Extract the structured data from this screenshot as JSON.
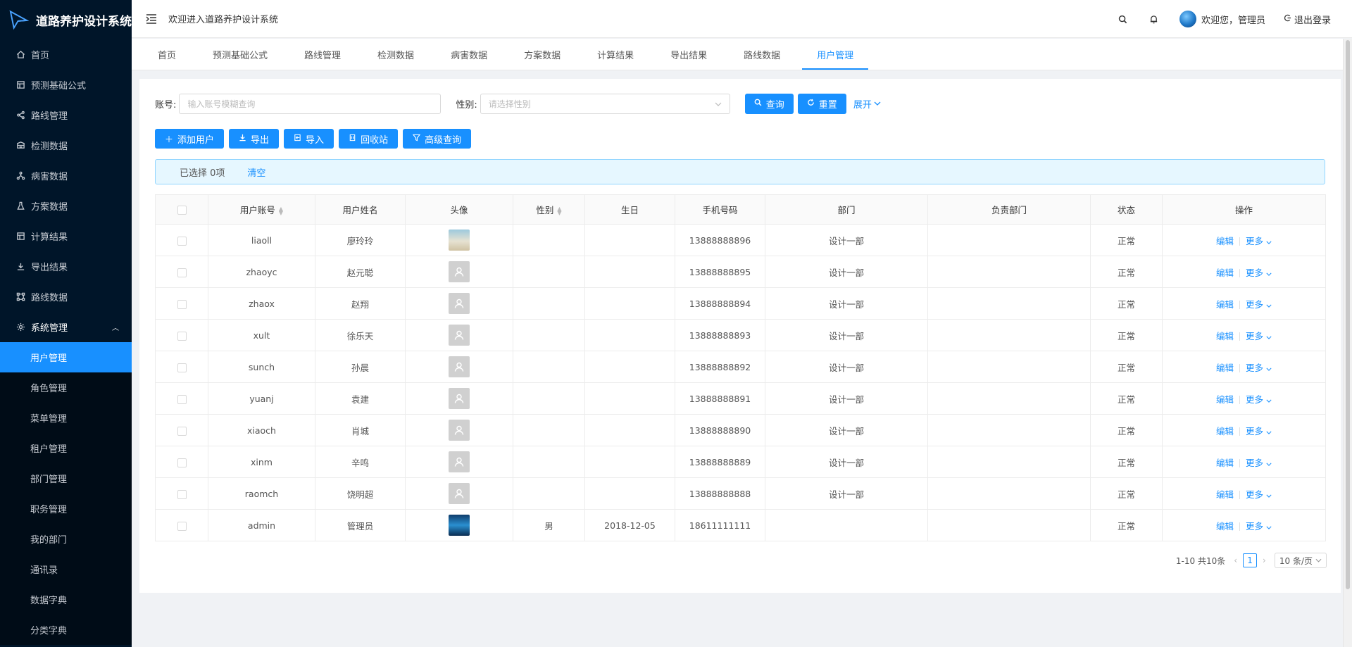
{
  "app": {
    "title": "道路养护设计系统",
    "welcome": "欢迎进入道路养护设计系统"
  },
  "header": {
    "greeting": "欢迎您，管理员",
    "logout": "退出登录"
  },
  "sidebar": {
    "items": [
      {
        "label": "首页",
        "icon": "home-icon"
      },
      {
        "label": "预测基础公式",
        "icon": "table-icon"
      },
      {
        "label": "路线管理",
        "icon": "share-icon"
      },
      {
        "label": "检测数据",
        "icon": "database-icon"
      },
      {
        "label": "病害数据",
        "icon": "cluster-icon"
      },
      {
        "label": "方案数据",
        "icon": "flask-icon"
      },
      {
        "label": "计算结果",
        "icon": "table-icon"
      },
      {
        "label": "导出结果",
        "icon": "download-icon"
      },
      {
        "label": "路线数据",
        "icon": "nodes-icon"
      }
    ],
    "system": {
      "label": "系统管理",
      "children": [
        "用户管理",
        "角色管理",
        "菜单管理",
        "租户管理",
        "部门管理",
        "职务管理",
        "我的部门",
        "通讯录",
        "数据字典",
        "分类字典"
      ]
    }
  },
  "tabs": [
    "首页",
    "预测基础公式",
    "路线管理",
    "检测数据",
    "病害数据",
    "方案数据",
    "计算结果",
    "导出结果",
    "路线数据",
    "用户管理"
  ],
  "active_tab": "用户管理",
  "search": {
    "account_label": "账号:",
    "account_placeholder": "输入账号模糊查询",
    "gender_label": "性别:",
    "gender_placeholder": "请选择性别",
    "query": "查询",
    "reset": "重置",
    "expand": "展开"
  },
  "toolbar": {
    "add": "添加用户",
    "export": "导出",
    "import": "导入",
    "recycle": "回收站",
    "advanced": "高级查询"
  },
  "selection": {
    "text": "已选择 0项",
    "clear": "清空"
  },
  "table": {
    "columns": [
      "用户账号",
      "用户姓名",
      "头像",
      "性别",
      "生日",
      "手机号码",
      "部门",
      "负责部门",
      "状态",
      "操作"
    ],
    "rows": [
      {
        "account": "liaoll",
        "name": "廖玲玲",
        "avatar": "photo-a",
        "gender": "",
        "birthday": "",
        "phone": "13888888896",
        "dept": "设计一部",
        "owner_dept": "",
        "status": "正常"
      },
      {
        "account": "zhaoyc",
        "name": "赵元聪",
        "avatar": "default",
        "gender": "",
        "birthday": "",
        "phone": "13888888895",
        "dept": "设计一部",
        "owner_dept": "",
        "status": "正常"
      },
      {
        "account": "zhaox",
        "name": "赵翔",
        "avatar": "default",
        "gender": "",
        "birthday": "",
        "phone": "13888888894",
        "dept": "设计一部",
        "owner_dept": "",
        "status": "正常"
      },
      {
        "account": "xult",
        "name": "徐乐天",
        "avatar": "default",
        "gender": "",
        "birthday": "",
        "phone": "13888888893",
        "dept": "设计一部",
        "owner_dept": "",
        "status": "正常"
      },
      {
        "account": "sunch",
        "name": "孙晨",
        "avatar": "default",
        "gender": "",
        "birthday": "",
        "phone": "13888888892",
        "dept": "设计一部",
        "owner_dept": "",
        "status": "正常"
      },
      {
        "account": "yuanj",
        "name": "袁建",
        "avatar": "default",
        "gender": "",
        "birthday": "",
        "phone": "13888888891",
        "dept": "设计一部",
        "owner_dept": "",
        "status": "正常"
      },
      {
        "account": "xiaoch",
        "name": "肖城",
        "avatar": "default",
        "gender": "",
        "birthday": "",
        "phone": "13888888890",
        "dept": "设计一部",
        "owner_dept": "",
        "status": "正常"
      },
      {
        "account": "xinm",
        "name": "辛鸣",
        "avatar": "default",
        "gender": "",
        "birthday": "",
        "phone": "13888888889",
        "dept": "设计一部",
        "owner_dept": "",
        "status": "正常"
      },
      {
        "account": "raomch",
        "name": "饶明超",
        "avatar": "default",
        "gender": "",
        "birthday": "",
        "phone": "13888888888",
        "dept": "设计一部",
        "owner_dept": "",
        "status": "正常"
      },
      {
        "account": "admin",
        "name": "管理员",
        "avatar": "photo-b",
        "gender": "男",
        "birthday": "2018-12-05",
        "phone": "18611111111",
        "dept": "",
        "owner_dept": "",
        "status": "正常"
      }
    ],
    "edit_label": "编辑",
    "more_label": "更多"
  },
  "pagination": {
    "summary": "1-10 共10条",
    "current": "1",
    "page_size": "10 条/页"
  }
}
